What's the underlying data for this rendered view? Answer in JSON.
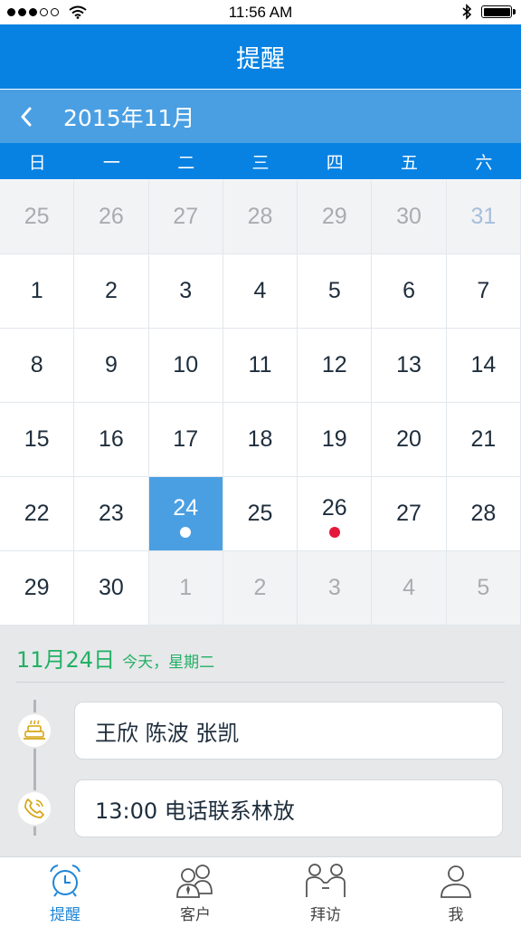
{
  "status_bar": {
    "time": "11:56 AM",
    "signal_dots_filled": 3,
    "signal_dots_total": 5,
    "battery_level": 1.0
  },
  "header": {
    "title": "提醒"
  },
  "calendar": {
    "month_label": "2015年11月",
    "weekdays": [
      "日",
      "一",
      "二",
      "三",
      "四",
      "五",
      "六"
    ],
    "weeks": [
      [
        {
          "day": "25",
          "state": "other"
        },
        {
          "day": "26",
          "state": "other"
        },
        {
          "day": "27",
          "state": "other"
        },
        {
          "day": "28",
          "state": "other"
        },
        {
          "day": "29",
          "state": "other"
        },
        {
          "day": "30",
          "state": "other"
        },
        {
          "day": "31",
          "state": "other-weekend"
        }
      ],
      [
        {
          "day": "1"
        },
        {
          "day": "2"
        },
        {
          "day": "3"
        },
        {
          "day": "4"
        },
        {
          "day": "5"
        },
        {
          "day": "6"
        },
        {
          "day": "7"
        }
      ],
      [
        {
          "day": "8"
        },
        {
          "day": "9"
        },
        {
          "day": "10"
        },
        {
          "day": "11"
        },
        {
          "day": "12"
        },
        {
          "day": "13"
        },
        {
          "day": "14"
        }
      ],
      [
        {
          "day": "15"
        },
        {
          "day": "16"
        },
        {
          "day": "17"
        },
        {
          "day": "18"
        },
        {
          "day": "19"
        },
        {
          "day": "20"
        },
        {
          "day": "21"
        }
      ],
      [
        {
          "day": "22"
        },
        {
          "day": "23"
        },
        {
          "day": "24",
          "state": "selected",
          "dot": "white"
        },
        {
          "day": "25"
        },
        {
          "day": "26",
          "dot": "red"
        },
        {
          "day": "27"
        },
        {
          "day": "28"
        }
      ],
      [
        {
          "day": "29"
        },
        {
          "day": "30"
        },
        {
          "day": "1",
          "state": "other"
        },
        {
          "day": "2",
          "state": "other"
        },
        {
          "day": "3",
          "state": "other"
        },
        {
          "day": "4",
          "state": "other"
        },
        {
          "day": "5",
          "state": "other"
        }
      ]
    ]
  },
  "agenda": {
    "date": "11月24日",
    "subtitle": "今天，星期二",
    "events": [
      {
        "icon": "birthday-cake-icon",
        "text": "王欣 陈波 张凯"
      },
      {
        "icon": "phone-call-icon",
        "text": "13:00 电话联系林放"
      }
    ]
  },
  "tabs": [
    {
      "label": "提醒",
      "icon": "alarm-clock-icon",
      "active": true
    },
    {
      "label": "客户",
      "icon": "customers-icon",
      "active": false
    },
    {
      "label": "拜访",
      "icon": "visit-handshake-icon",
      "active": false
    },
    {
      "label": "我",
      "icon": "profile-icon",
      "active": false
    }
  ],
  "colors": {
    "primary_blue": "#0782e2",
    "month_bar_blue": "#4a9fe3",
    "agenda_green": "#23b064",
    "event_dot_red": "#e5173a",
    "tab_active_blue": "#1f86d8"
  }
}
